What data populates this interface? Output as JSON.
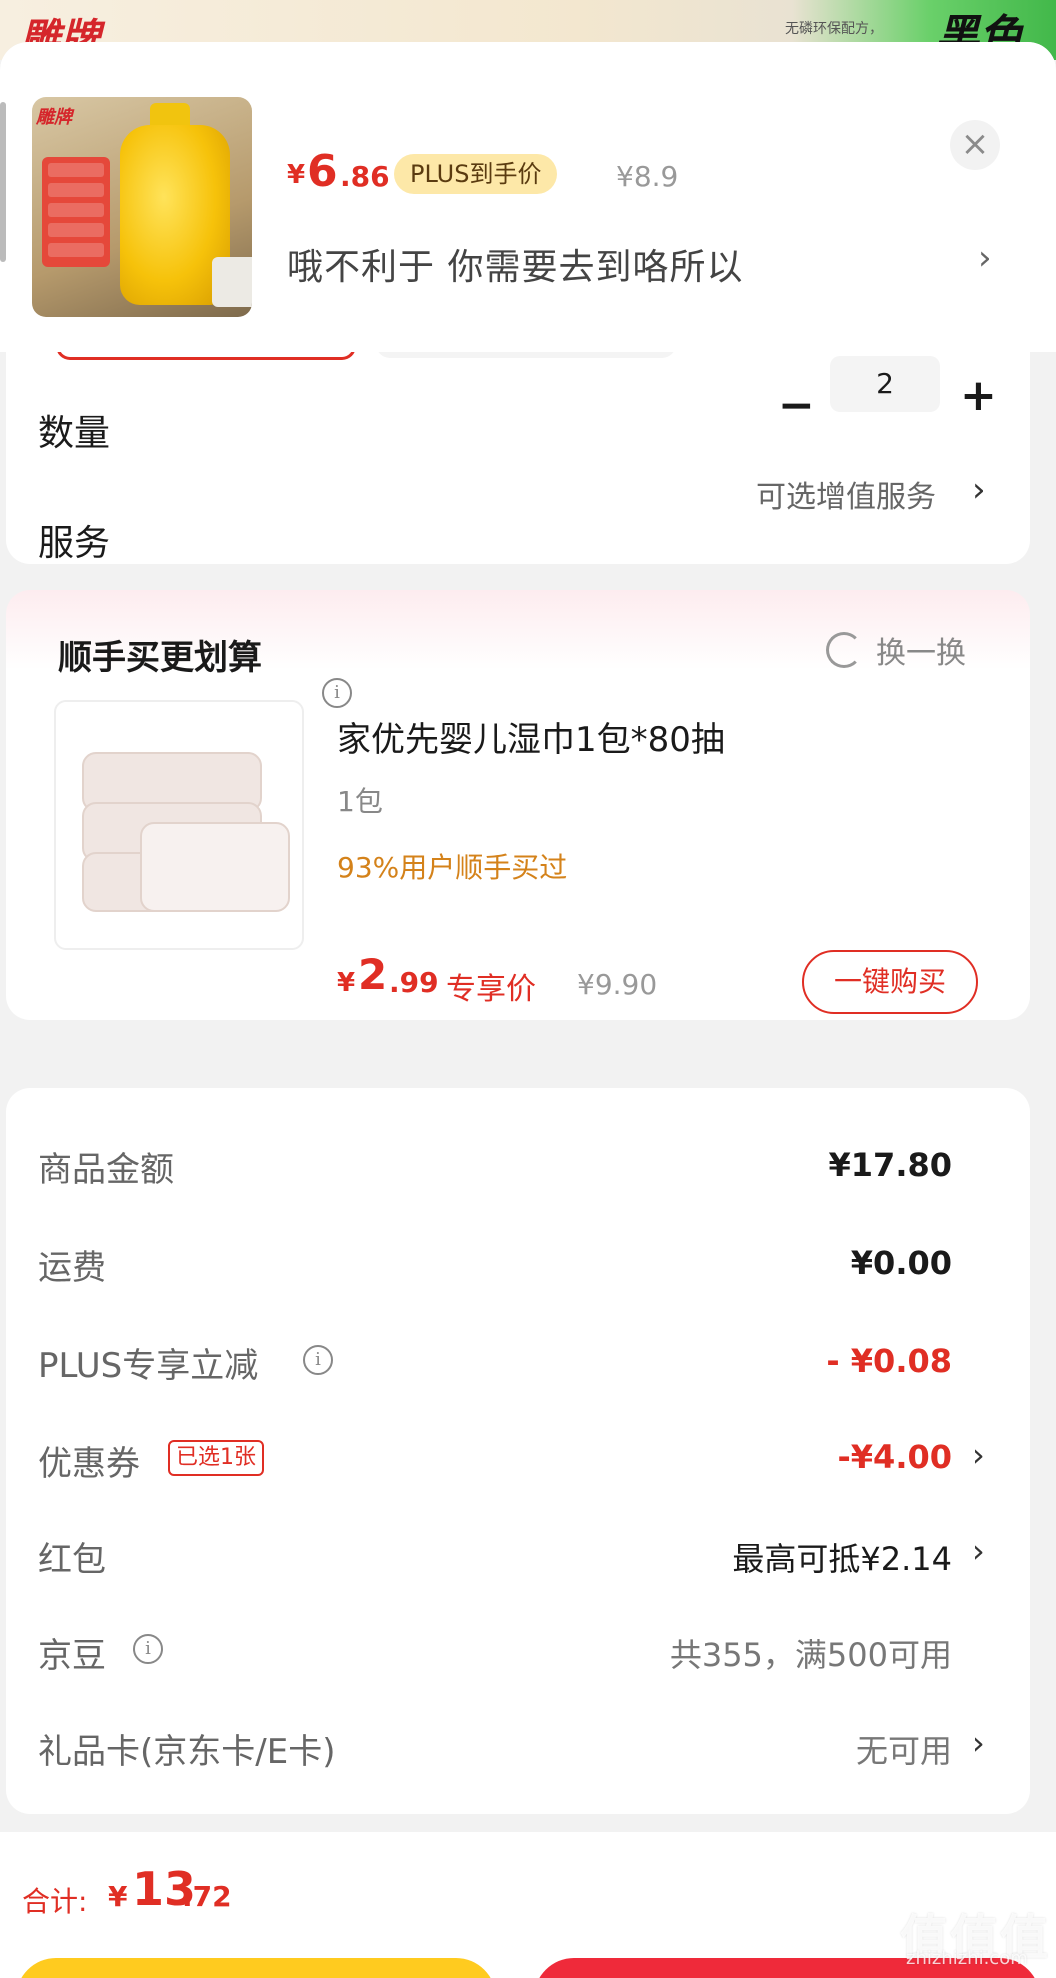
{
  "background": {
    "brand_logo": "雕牌",
    "note": "无磷环保配方，",
    "black_text": "黑色"
  },
  "product": {
    "price_yen": "¥",
    "price_int": "6",
    "price_dec": ".86",
    "plus_tag": "PLUS到手价",
    "original_price": "¥8.9",
    "spec_text": "哦不利于  你需要去到咯所以",
    "close_icon": "×",
    "spec_arrow": "›"
  },
  "quantity": {
    "label": "数量",
    "minus": "−",
    "value": "2",
    "plus": "+"
  },
  "service": {
    "label": "服务",
    "value": "可选增值服务",
    "arrow": "›"
  },
  "recommend": {
    "title": "顺手买更划算",
    "info_icon": "i",
    "swap_label": "换一换",
    "item": {
      "name": "家优先婴儿湿巾1包*80抽",
      "spec": "1包",
      "stat": "93%用户顺手买过",
      "price_yen": "¥",
      "price_int": "2",
      "price_dec": ".99",
      "price_tag": "专享价",
      "original_price": "¥9.90",
      "buy_label": "一键购买"
    }
  },
  "summary": {
    "rows": [
      {
        "label": "商品金额",
        "value": "¥17.80"
      },
      {
        "label": "运费",
        "value": "¥0.00"
      },
      {
        "label": "PLUS专享立减",
        "value": "- ¥0.08"
      },
      {
        "label": "优惠券",
        "badge": "已选1张",
        "value": "-¥4.00"
      },
      {
        "label": "红包",
        "value": "最高可抵¥2.14"
      },
      {
        "label": "京豆",
        "value": "共355，满500可用"
      },
      {
        "label": "礼品卡(京东卡/E卡)",
        "value": "无可用"
      }
    ],
    "arrow": "›"
  },
  "footer": {
    "total_label": "合计:",
    "total_yen": "¥",
    "total_int": "13",
    "total_dec": ".72"
  },
  "watermark": {
    "main": "值值值",
    "sub": "zhizhizhi.com"
  },
  "colors": {
    "accent_red": "#e02e24",
    "plus_gold": "#fde8a8",
    "stat_orange": "#d4821a",
    "cta_yellow": "#ffcb1f",
    "cta_red": "#ef2a3a"
  }
}
